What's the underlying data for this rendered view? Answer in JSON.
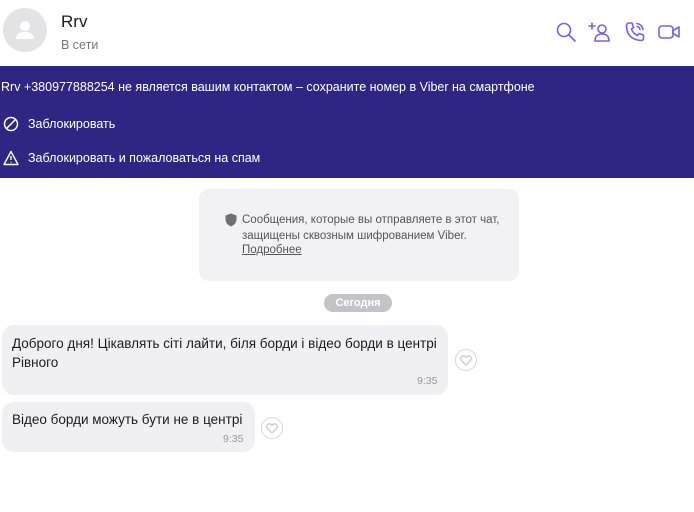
{
  "header": {
    "name": "Rrv",
    "status": "В сети",
    "icons": [
      "search-icon",
      "add-participant-icon",
      "voice-call-icon",
      "video-call-icon"
    ],
    "accent": "#7360f2"
  },
  "banner": {
    "background": "#2f2683",
    "text": "Rrv +380977888254 не является вашим контактом – сохраните номер в Viber на смартфоне",
    "block_label": "Заблокировать",
    "block_report_label": "Заблокировать и пожаловаться на спам"
  },
  "notice": {
    "text": "Сообщения, которые вы отправляете в этот чат, защищены сквозным шифрованием Viber.",
    "link": "Подробнее"
  },
  "date_label": "Сегодня",
  "messages": [
    {
      "text": "Доброго дня! Цікавлять сіті лайти, біля борди і відео борди в центрі Рівного",
      "time": "9:35"
    },
    {
      "text": "Відео борди можуть бути не в центрі",
      "time": "9:35"
    }
  ]
}
